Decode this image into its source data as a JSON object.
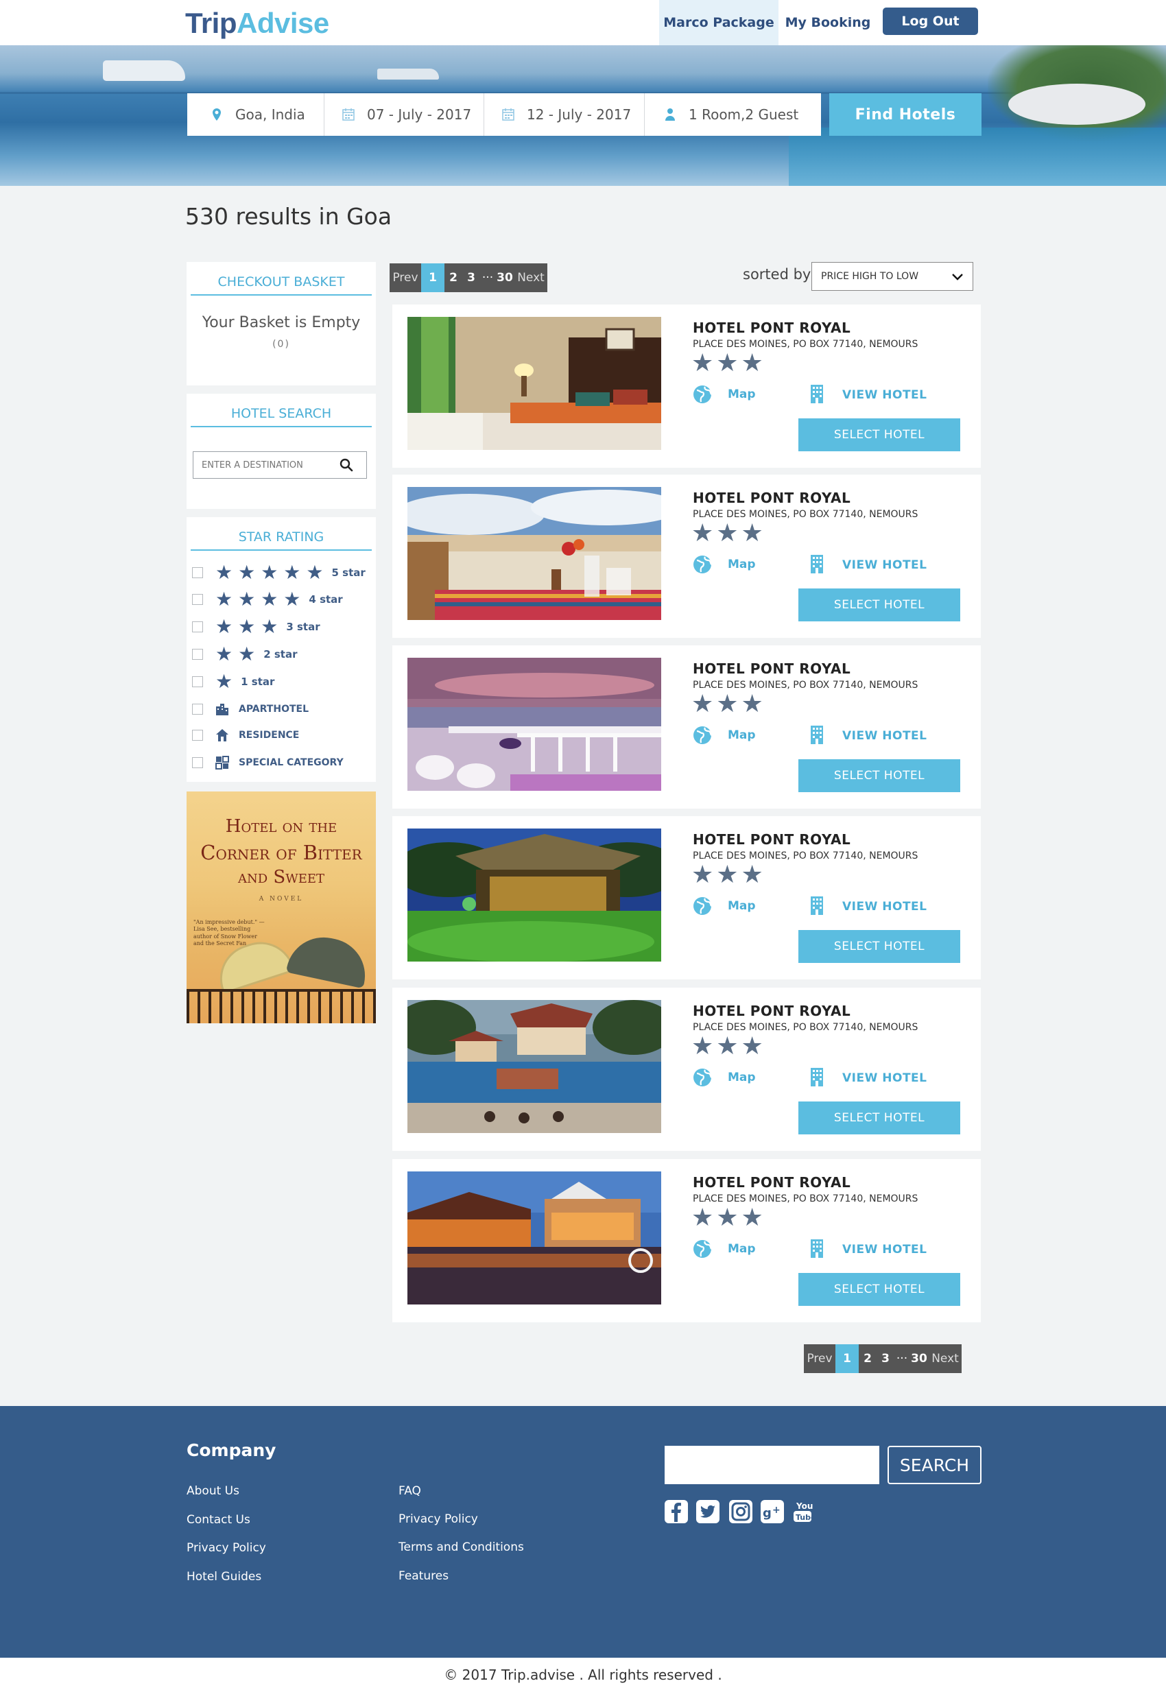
{
  "header": {
    "logo_part1": "Trip",
    "logo_part2": "Advise",
    "nav_marco": "Marco Package",
    "nav_booking": "My Booking",
    "nav_logout": "Log Out"
  },
  "search": {
    "location": "Goa, India",
    "checkin": "07 - July - 2017",
    "checkout": "12 - July - 2017",
    "guests": "1 Room,2 Guest",
    "find_button": "Find  Hotels"
  },
  "results_title": "530 results in Goa",
  "sidebar": {
    "basket_title": "CHECKOUT BASKET",
    "basket_empty": "Your Basket is Empty",
    "basket_count": "(0)",
    "hotel_search_title": "HOTEL SEARCH",
    "destination_placeholder": "ENTER A DESTINATION",
    "star_rating_title": "STAR RATING",
    "ratings": [
      {
        "stars": "★★★★★",
        "label": "5 star"
      },
      {
        "stars": "★★★★",
        "label": "4 star"
      },
      {
        "stars": "★★★",
        "label": "3 star"
      },
      {
        "stars": "★★",
        "label": "2 star"
      },
      {
        "stars": "★",
        "label": "1 star"
      }
    ],
    "types": [
      {
        "label": "APARTHOTEL",
        "icon": "building-icon"
      },
      {
        "label": "RESIDENCE",
        "icon": "home-icon"
      },
      {
        "label": "SPECIAL CATEGORY",
        "icon": "grid-icon"
      }
    ],
    "ad": {
      "line1": "Hotel on the",
      "line2": "Corner of Bitter",
      "line3": "and Sweet",
      "novel": "A NOVEL",
      "quote": "\"An impressive debut.\" —Lisa See, bestselling author of Snow Flower and the Secret Fan"
    }
  },
  "pagination": {
    "prev": "Prev",
    "pages": [
      "1",
      "2",
      "3"
    ],
    "dots": "···",
    "last": "30",
    "next": "Next",
    "current": 1
  },
  "sort": {
    "label": "sorted by",
    "value": "PRICE HIGH TO LOW"
  },
  "hotels": [
    {
      "name": "HOTEL PONT ROYAL",
      "address": "PLACE DES MOINES, PO BOX 77140, NEMOURS",
      "stars": "★★★",
      "map": "Map",
      "view": "VIEW HOTEL",
      "select": "SELECT HOTEL"
    },
    {
      "name": "HOTEL PONT ROYAL",
      "address": "PLACE DES MOINES, PO BOX 77140, NEMOURS",
      "stars": "★★★",
      "map": "Map",
      "view": "VIEW HOTEL",
      "select": "SELECT HOTEL"
    },
    {
      "name": "HOTEL PONT ROYAL",
      "address": "PLACE DES MOINES, PO BOX 77140, NEMOURS",
      "stars": "★★★",
      "map": "Map",
      "view": "VIEW HOTEL",
      "select": "SELECT HOTEL"
    },
    {
      "name": "HOTEL PONT ROYAL",
      "address": "PLACE DES MOINES, PO BOX 77140, NEMOURS",
      "stars": "★★★",
      "map": "Map",
      "view": "VIEW HOTEL",
      "select": "SELECT HOTEL"
    },
    {
      "name": "HOTEL PONT ROYAL",
      "address": "PLACE DES MOINES, PO BOX 77140, NEMOURS",
      "stars": "★★★",
      "map": "Map",
      "view": "VIEW HOTEL",
      "select": "SELECT HOTEL"
    },
    {
      "name": "HOTEL PONT ROYAL",
      "address": "PLACE DES MOINES, PO BOX 77140, NEMOURS",
      "stars": "★★★",
      "map": "Map",
      "view": "VIEW HOTEL",
      "select": "SELECT HOTEL"
    }
  ],
  "footer": {
    "company_title": "Company",
    "col1": [
      "About Us",
      "Contact Us",
      "Privacy Policy",
      "Hotel Guides"
    ],
    "col2": [
      "FAQ",
      "Privacy Policy",
      "Terms and Conditions",
      "Features"
    ],
    "search_button": "SEARCH",
    "social": [
      "facebook-icon",
      "twitter-icon",
      "instagram-icon",
      "google-plus-icon",
      "youtube-icon"
    ],
    "copyright": "© 2017 Trip.advise . All rights reserved ."
  },
  "colors": {
    "brand_dark": "#345c8c",
    "accent": "#5bbde0",
    "footer_bg": "#355c8a"
  }
}
